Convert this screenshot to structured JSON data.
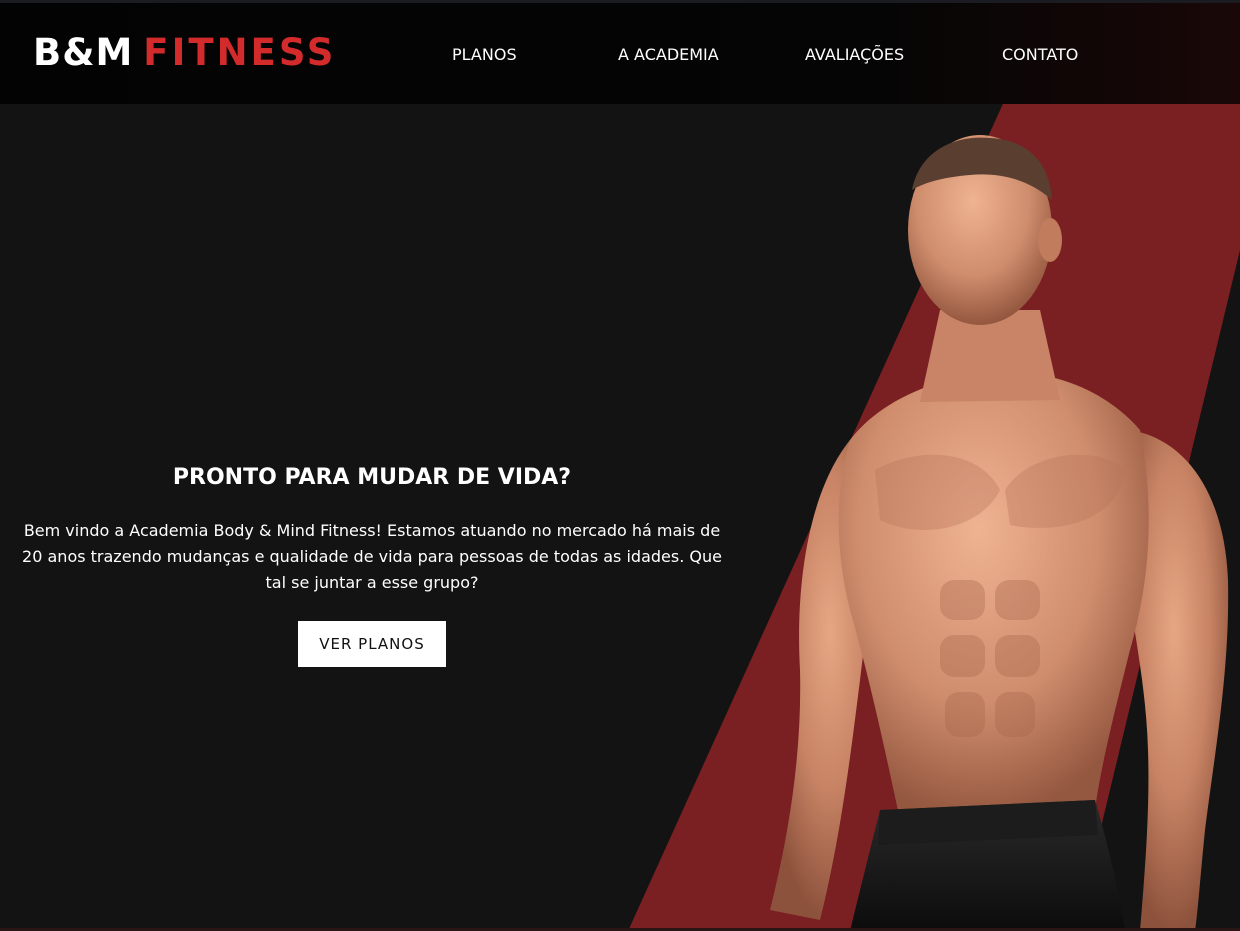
{
  "brand": {
    "part1": "B&M",
    "part2": "FITNESS"
  },
  "nav": {
    "items": [
      "PLANOS",
      "A ACADEMIA",
      "AVALIAÇÕES",
      "CONTATO"
    ]
  },
  "hero": {
    "title": "PRONTO PARA MUDAR DE VIDA?",
    "description": "Bem vindo a Academia Body & Mind Fitness! Estamos atuando no mercado há mais de 20 anos trazendo mudanças e qualidade de vida para pessoas de todas as idades. Que tal se juntar a esse grupo?",
    "cta_label": "VER PLANOS"
  },
  "colors": {
    "accent": "#d32b2b",
    "band": "#7a1f22",
    "background": "#131314"
  },
  "image": {
    "subject": "bodybuilder-photo"
  }
}
